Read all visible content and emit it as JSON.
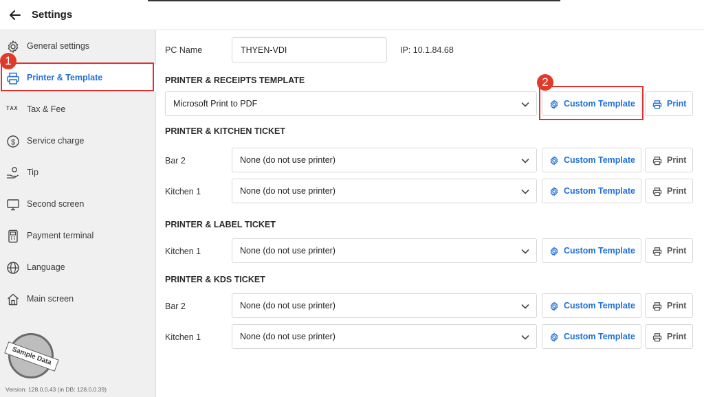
{
  "header": {
    "title": "Settings"
  },
  "sidebar": {
    "items": [
      {
        "label": "General settings",
        "icon": "gear-icon"
      },
      {
        "label": "Printer & Template",
        "icon": "printer-icon"
      },
      {
        "label": "Tax & Fee",
        "icon": "tax-icon",
        "icon_text": "TAX"
      },
      {
        "label": "Service charge",
        "icon": "dollar-circle-icon"
      },
      {
        "label": "Tip",
        "icon": "tip-hand-icon"
      },
      {
        "label": "Second screen",
        "icon": "monitor-icon"
      },
      {
        "label": "Payment terminal",
        "icon": "payment-terminal-icon"
      },
      {
        "label": "Language",
        "icon": "globe-icon"
      },
      {
        "label": "Main screen",
        "icon": "home-icon"
      }
    ],
    "stamp_text": "Sample Data",
    "version": "Version:  128.0.0.43  (in DB: 128.0.0.39)"
  },
  "callouts": {
    "step1": "1",
    "step2": "2"
  },
  "pc": {
    "label": "PC Name",
    "value": "THYEN-VDI",
    "ip": "IP: 10.1.84.68"
  },
  "receipts": {
    "title": "PRINTER & RECEIPTS TEMPLATE",
    "selected": "Microsoft Print to PDF",
    "custom_label": "Custom Template",
    "print_label": "Print"
  },
  "kitchen": {
    "title": "PRINTER & KITCHEN TICKET",
    "rows": [
      {
        "label": "Bar 2",
        "selected": "None (do not use printer)",
        "custom_label": "Custom Template",
        "print_label": "Print"
      },
      {
        "label": "Kitchen 1",
        "selected": "None (do not use printer)",
        "custom_label": "Custom Template",
        "print_label": "Print"
      }
    ]
  },
  "label_ticket": {
    "title": "PRINTER & LABEL TICKET",
    "rows": [
      {
        "label": "Kitchen 1",
        "selected": "None (do not use printer)",
        "custom_label": "Custom Template",
        "print_label": "Print"
      }
    ]
  },
  "kds": {
    "title": "PRINTER & KDS TICKET",
    "rows": [
      {
        "label": "Bar 2",
        "selected": "None (do not use printer)",
        "custom_label": "Custom Template",
        "print_label": "Print"
      },
      {
        "label": "Kitchen 1",
        "selected": "None (do not use printer)",
        "custom_label": "Custom Template",
        "print_label": "Print"
      }
    ]
  },
  "colors": {
    "accent": "#1f6fd6",
    "highlight": "#e03030",
    "badge": "#e03a2a",
    "sidebar_bg": "#f0f0f0"
  }
}
